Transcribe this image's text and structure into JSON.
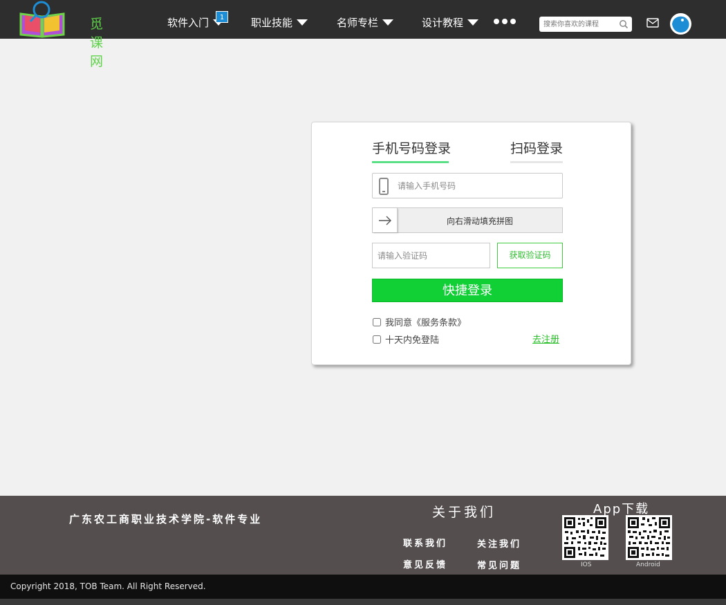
{
  "header": {
    "logo_text": "觅课网",
    "nav": [
      {
        "label": "软件入门"
      },
      {
        "label": "职业技能"
      },
      {
        "label": "名师专栏"
      },
      {
        "label": "设计教程"
      }
    ],
    "badge": "1",
    "search_placeholder": "搜索你喜欢的课程"
  },
  "login": {
    "tab_phone": "手机号码登录",
    "tab_qr": "扫码登录",
    "phone_placeholder": "请输入手机号码",
    "slider_text": "向右滑动填充拼图",
    "code_placeholder": "请输入验证码",
    "get_code": "获取验证码",
    "submit": "快捷登录",
    "agree": "我同意《服务条款》",
    "remember": "十天内免登陆",
    "register": "去注册"
  },
  "footer": {
    "school": "广东农工商职业技术学院-软件专业",
    "about_title": "关于我们",
    "links": [
      "联系我们",
      "关注我们",
      "意见反馈",
      "常见问题"
    ],
    "app_title": "App下载",
    "ios_label": "IOS",
    "android_label": "Android",
    "copyright": "Copyright 2018, TOB Team. All Right Reserved."
  },
  "colors": {
    "header_bg": "#2e2e2e",
    "accent_green": "#11d035",
    "footer_bg": "#544e4f"
  }
}
